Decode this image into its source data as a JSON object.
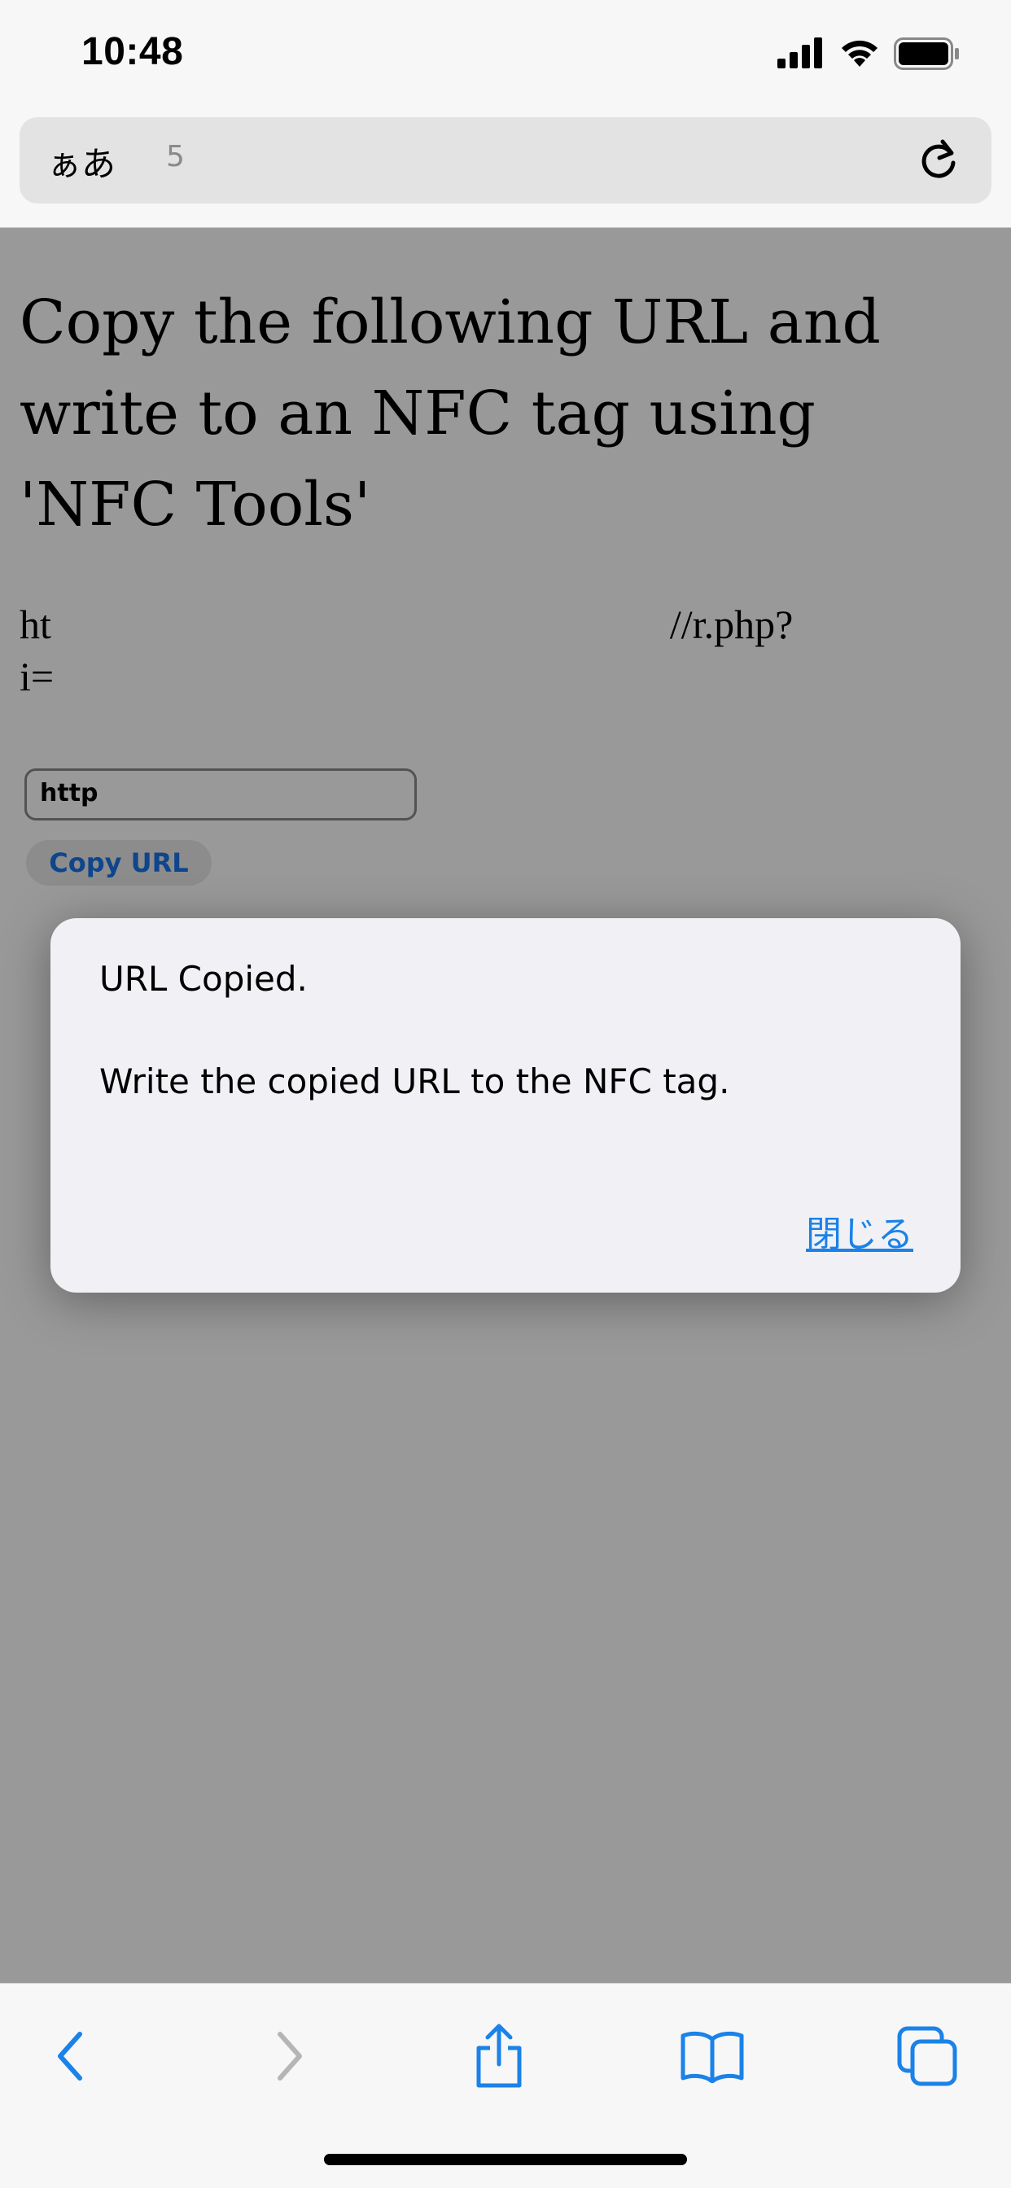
{
  "status_bar": {
    "time": "10:48"
  },
  "address_bar": {
    "aa_label": "ぁあ",
    "url_fragment": "5"
  },
  "page": {
    "heading": "Copy the following URL and write to an NFC tag using 'NFC Tools'",
    "url_text_start": "ht",
    "url_text_end": "//r.php?",
    "url_line2_start": "i=",
    "input_value": "http",
    "copy_button_label": "Copy URL"
  },
  "dialog": {
    "title": "URL Copied.",
    "message": "Write the copied URL to the NFC tag.",
    "close_label": "閉じる"
  },
  "toolbar": {
    "icons": [
      "back-icon",
      "forward-icon",
      "share-icon",
      "bookmarks-icon",
      "tabs-icon"
    ]
  },
  "colors": {
    "accent": "#1a82e8",
    "overlay": "rgba(0,0,0,0.40)",
    "dialog_bg": "#f1f1f5"
  }
}
